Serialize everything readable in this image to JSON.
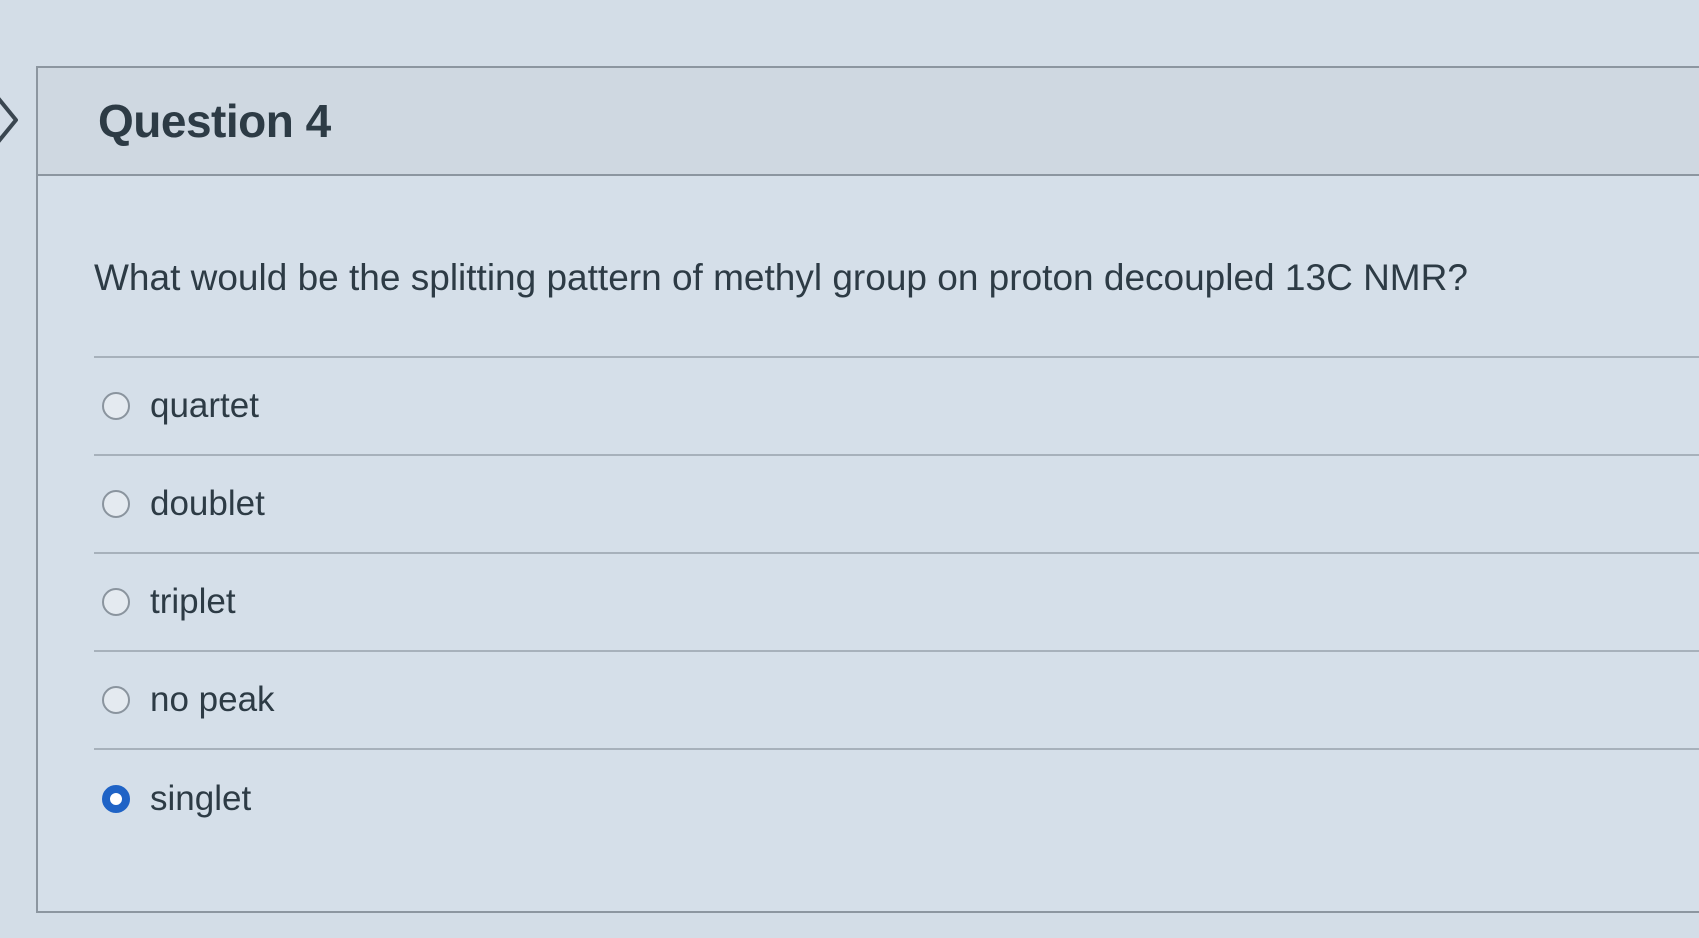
{
  "question": {
    "title": "Question 4",
    "text": "What would be the splitting pattern of methyl group on proton decoupled 13C NMR?"
  },
  "answers": [
    {
      "label": "quartet",
      "selected": false
    },
    {
      "label": "doublet",
      "selected": false
    },
    {
      "label": "triplet",
      "selected": false
    },
    {
      "label": "no peak",
      "selected": false
    },
    {
      "label": "singlet",
      "selected": true
    }
  ],
  "colors": {
    "accent": "#1f63c6",
    "text": "#2d3b45",
    "background": "#d3dde7"
  }
}
